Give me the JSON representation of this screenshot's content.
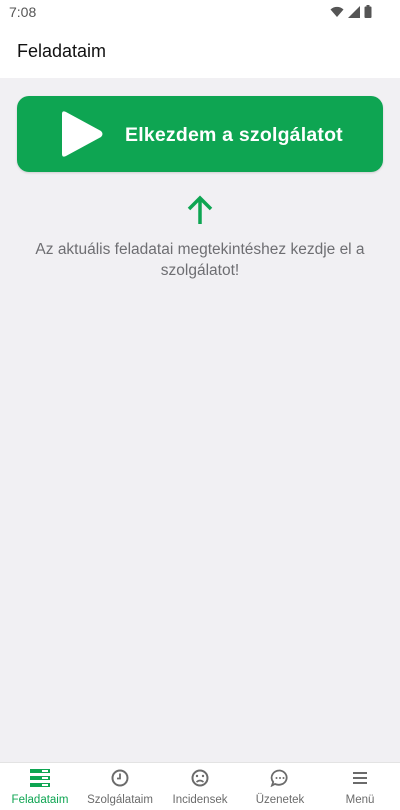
{
  "status_bar": {
    "time": "7:08",
    "icons": [
      "wifi-icon",
      "signal-icon",
      "battery-icon"
    ]
  },
  "app_bar": {
    "title": "Feladataim"
  },
  "main": {
    "start_button_label": "Elkezdem a szolgálatot",
    "start_button_icon": "play-icon",
    "arrow_icon": "arrow-up-icon",
    "hint": "Az aktuális feladatai megtekintéshez kezdje el a szolgálatot!"
  },
  "bottom_nav": {
    "items": [
      {
        "label": "Feladataim",
        "icon": "tasks-icon",
        "active": true
      },
      {
        "label": "Szolgálataim",
        "icon": "clock-icon",
        "active": false
      },
      {
        "label": "Incidensek",
        "icon": "sad-face-icon",
        "active": false
      },
      {
        "label": "Üzenetek",
        "icon": "chat-bubble-icon",
        "active": false
      },
      {
        "label": "Menü",
        "icon": "hamburger-menu-icon",
        "active": false
      }
    ]
  },
  "colors": {
    "accent": "#0ea552",
    "background": "#f1f0f3",
    "text_muted": "#6e6e72"
  }
}
